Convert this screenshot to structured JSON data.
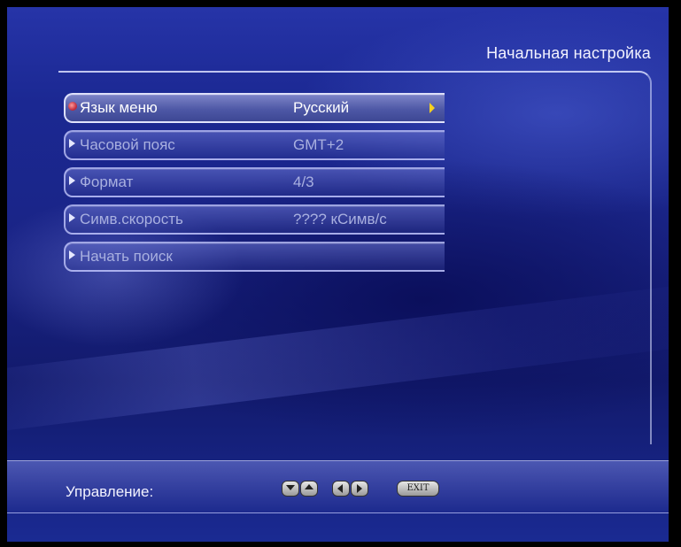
{
  "screen": {
    "title": "Начальная настройка"
  },
  "menu": {
    "items": [
      {
        "label": "Язык меню",
        "value": "Русский",
        "active": true
      },
      {
        "label": "Часовой пояс",
        "value": "GMT+2",
        "active": false
      },
      {
        "label": "Формат",
        "value": "4/3",
        "active": false
      },
      {
        "label": "Симв.скорость",
        "value": "????  кСимв/с",
        "active": false
      },
      {
        "label": "Начать поиск",
        "value": "",
        "active": false
      }
    ]
  },
  "footer": {
    "control_label": "Управление:",
    "buttons": [
      "down-arrow-icon",
      "up-arrow-icon",
      "left-arrow-icon",
      "right-arrow-icon"
    ],
    "exit_label": "EXIT"
  }
}
